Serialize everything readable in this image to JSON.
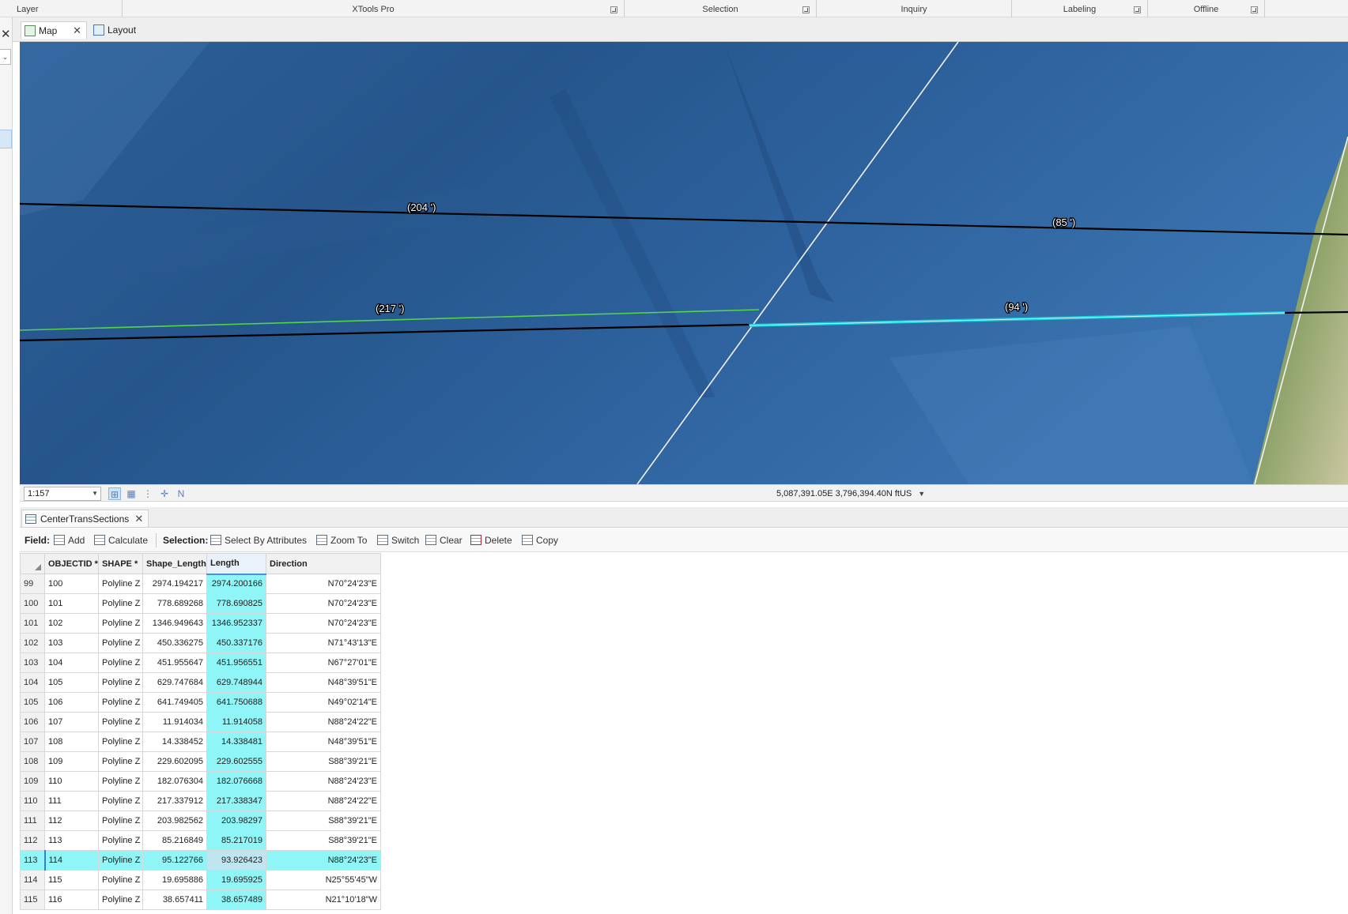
{
  "ribbon": {
    "groups": [
      {
        "label": "Layer",
        "launcher": false
      },
      {
        "label": "XTools Pro",
        "launcher": true
      },
      {
        "label": "Selection",
        "launcher": true
      },
      {
        "label": "Inquiry",
        "launcher": false
      },
      {
        "label": "Labeling",
        "launcher": true
      },
      {
        "label": "Offline",
        "launcher": true
      }
    ]
  },
  "views": {
    "tabs": [
      {
        "label": "Map",
        "active": true
      },
      {
        "label": "Layout",
        "active": false
      }
    ]
  },
  "map": {
    "labels": [
      "(204 ')",
      "(85 ')",
      "(217 ')",
      "(94 ')"
    ],
    "colors": {
      "water": "#2a5d95",
      "selected_line": "#16c8da",
      "highlight_line": "#52d64a",
      "parcel_line": "#000000",
      "boundary_line": "#ffffff"
    }
  },
  "status": {
    "scale": "1:157",
    "coordinates": "5,087,391.05E 3,796,394.40N ftUS",
    "icons": [
      "full-extent-icon",
      "grid-icon",
      "snapping-icon",
      "constraints-icon",
      "north-arrow-icon"
    ]
  },
  "table_view": {
    "tab_label": "CenterTransSections",
    "toolbar": {
      "field_label": "Field:",
      "add_label": "Add",
      "calculate_label": "Calculate",
      "selection_label": "Selection:",
      "select_by_attributes_label": "Select By Attributes",
      "zoom_to_label": "Zoom To",
      "switch_label": "Switch",
      "clear_label": "Clear",
      "delete_label": "Delete",
      "copy_label": "Copy"
    },
    "columns": [
      "OBJECTID *",
      "SHAPE *",
      "Shape_Length",
      "Length",
      "Direction"
    ],
    "rows": [
      {
        "row": "99",
        "objectid": "100",
        "shape": "Polyline Z",
        "shape_length": "2974.194217",
        "length": "2974.200166",
        "direction": "N70°24'23\"E"
      },
      {
        "row": "100",
        "objectid": "101",
        "shape": "Polyline Z",
        "shape_length": "778.689268",
        "length": "778.690825",
        "direction": "N70°24'23\"E"
      },
      {
        "row": "101",
        "objectid": "102",
        "shape": "Polyline Z",
        "shape_length": "1346.949643",
        "length": "1346.952337",
        "direction": "N70°24'23\"E"
      },
      {
        "row": "102",
        "objectid": "103",
        "shape": "Polyline Z",
        "shape_length": "450.336275",
        "length": "450.337176",
        "direction": "N71°43'13\"E"
      },
      {
        "row": "103",
        "objectid": "104",
        "shape": "Polyline Z",
        "shape_length": "451.955647",
        "length": "451.956551",
        "direction": "N67°27'01\"E"
      },
      {
        "row": "104",
        "objectid": "105",
        "shape": "Polyline Z",
        "shape_length": "629.747684",
        "length": "629.748944",
        "direction": "N48°39'51\"E"
      },
      {
        "row": "105",
        "objectid": "106",
        "shape": "Polyline Z",
        "shape_length": "641.749405",
        "length": "641.750688",
        "direction": "N49°02'14\"E"
      },
      {
        "row": "106",
        "objectid": "107",
        "shape": "Polyline Z",
        "shape_length": "11.914034",
        "length": "11.914058",
        "direction": "N88°24'22\"E"
      },
      {
        "row": "107",
        "objectid": "108",
        "shape": "Polyline Z",
        "shape_length": "14.338452",
        "length": "14.338481",
        "direction": "N48°39'51\"E"
      },
      {
        "row": "108",
        "objectid": "109",
        "shape": "Polyline Z",
        "shape_length": "229.602095",
        "length": "229.602555",
        "direction": "S88°39'21\"E"
      },
      {
        "row": "109",
        "objectid": "110",
        "shape": "Polyline Z",
        "shape_length": "182.076304",
        "length": "182.076668",
        "direction": "N88°24'23\"E"
      },
      {
        "row": "110",
        "objectid": "111",
        "shape": "Polyline Z",
        "shape_length": "217.337912",
        "length": "217.338347",
        "direction": "N88°24'22\"E"
      },
      {
        "row": "111",
        "objectid": "112",
        "shape": "Polyline Z",
        "shape_length": "203.982562",
        "length": "203.98297",
        "direction": "S88°39'21\"E"
      },
      {
        "row": "112",
        "objectid": "113",
        "shape": "Polyline Z",
        "shape_length": "85.216849",
        "length": "85.217019",
        "direction": "S88°39'21\"E"
      },
      {
        "row": "113",
        "objectid": "114",
        "shape": "Polyline Z",
        "shape_length": "95.122766",
        "length": "93.926423",
        "direction": "N88°24'23\"E",
        "selected": true
      },
      {
        "row": "114",
        "objectid": "115",
        "shape": "Polyline Z",
        "shape_length": "19.695886",
        "length": "19.695925",
        "direction": "N25°55'45\"W"
      },
      {
        "row": "115",
        "objectid": "116",
        "shape": "Polyline Z",
        "shape_length": "38.657411",
        "length": "38.657489",
        "direction": "N21°10'18\"W"
      }
    ]
  }
}
